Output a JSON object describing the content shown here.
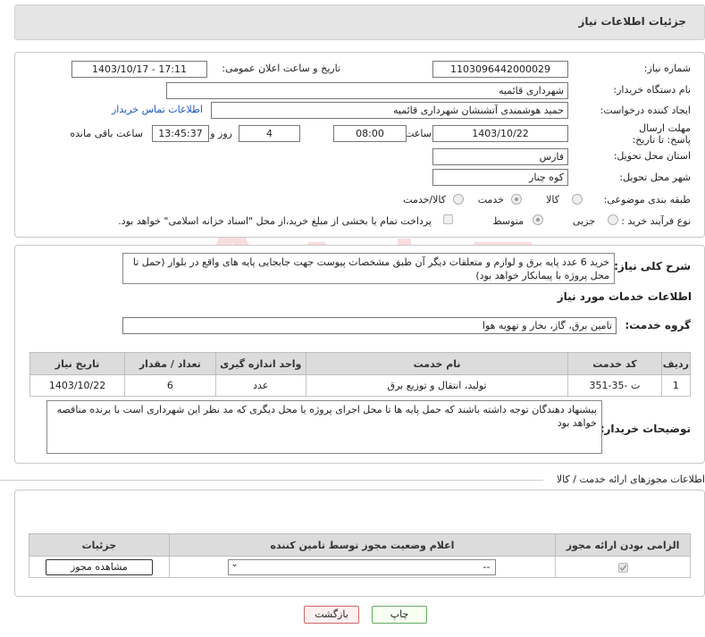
{
  "header": {
    "title": "جزئیات اطلاعات نیاز"
  },
  "watermark": {
    "text": "AriaTender.neT"
  },
  "form": {
    "need_number_label": "شماره نیاز:",
    "need_number": "1103096442000029",
    "announce_label": "تاریخ و ساعت اعلان عمومی:",
    "announce_value": "1403/10/17 - 17:11",
    "buyer_org_label": "نام دستگاه خریدار:",
    "buyer_org": "شهرداری قائمیه",
    "creator_label": "ایجاد کننده درخواست:",
    "creator": "حمید هوشمندی آتشنشان شهرداری قائمیه",
    "contact_link": "اطلاعات تماس خریدار",
    "deadline_label": "مهلت ارسال پاسخ: تا تاریخ:",
    "deadline_date": "1403/10/22",
    "time_label": "ساعت",
    "deadline_time": "08:00",
    "days_value": "4",
    "days_label": "روز و",
    "remaining_time": "13:45:37",
    "remaining_label": "ساعت باقی مانده",
    "province_label": "استان محل تحویل:",
    "province": "فارس",
    "city_label": "شهر محل تحویل:",
    "city": "کوه چنار",
    "category_label": "طبقه بندی موضوعی:",
    "category_options": [
      "کالا",
      "خدمت",
      "کالا/خدمت"
    ],
    "category_selected": "خدمت",
    "process_label": "نوع فرآیند خرید :",
    "process_options": [
      "جزیی",
      "متوسط"
    ],
    "process_selected": "جزیی",
    "payment_note": "پرداخت تمام یا بخشی از مبلغ خرید،از محل \"اسناد خزانه اسلامی\" خواهد بود."
  },
  "details": {
    "desc_label": "شرح کلی نیاز:",
    "desc_value": "خرید 6 عدد پایه برق و لوازم و متعلقات دیگر آن طبق مشخصات پیوست جهت جابجایی پایه های واقع در بلوار (حمل تا محل پروژه با پیمانکار خواهد بود)",
    "services_title": "اطلاعات خدمات مورد نیاز",
    "group_label": "گروه خدمت:",
    "group_value": "تامین برق، گاز، بخار و تهویه هوا",
    "table": {
      "headers": [
        "ردیف",
        "کد خدمت",
        "نام خدمت",
        "واحد اندازه گیری",
        "تعداد / مقدار",
        "تاریخ نیاز"
      ],
      "rows": [
        [
          "1",
          "ت -35-351",
          "تولید، انتقال و توزیع برق",
          "عدد",
          "6",
          "1403/10/22"
        ]
      ]
    },
    "buyer_notes_label": "توضیحات خریدار:",
    "buyer_notes": "پیشنهاد دهندگان توجه داشته باشند که حمل پایه ها تا محل اجرای پروژه یا محل دیگری که مد نظر این شهرداری است با برنده مناقصه خواهد بود"
  },
  "permits": {
    "section_title": "اطلاعات مجوزهای ارائه خدمت / کالا",
    "headers": [
      "الزامی بودن ارائه مجوز",
      "اعلام وضعیت مجوز توسط تامین کننده",
      "جزئیات"
    ],
    "select_value": "--",
    "view_button": "مشاهده مجوز"
  },
  "footer": {
    "print_button": "چاپ",
    "back_button": "بازگشت"
  }
}
